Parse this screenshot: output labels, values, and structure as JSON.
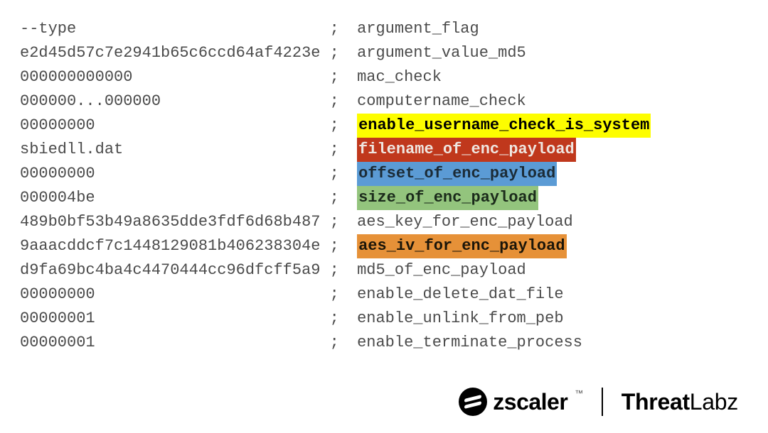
{
  "rows": [
    {
      "value": "--type",
      "semi": ";",
      "comment": "argument_flag",
      "hl": null
    },
    {
      "value": "e2d45d57c7e2941b65c6ccd64af4223e",
      "semi": ";",
      "comment": "argument_value_md5",
      "hl": null
    },
    {
      "value": "000000000000",
      "semi": ";",
      "comment": "mac_check",
      "hl": null
    },
    {
      "value": "000000...000000",
      "semi": ";",
      "comment": "computername_check",
      "hl": null
    },
    {
      "value": "00000000",
      "semi": ";",
      "comment": "enable_username_check_is_system",
      "hl": "yellow"
    },
    {
      "value": "sbiedll.dat",
      "semi": ";",
      "comment": "filename_of_enc_payload",
      "hl": "red"
    },
    {
      "value": "00000000",
      "semi": ";",
      "comment": "offset_of_enc_payload",
      "hl": "blue"
    },
    {
      "value": "000004be",
      "semi": ";",
      "comment": "size_of_enc_payload",
      "hl": "green"
    },
    {
      "value": "489b0bf53b49a8635dde3fdf6d68b487",
      "semi": ";",
      "comment": "aes_key_for_enc_payload",
      "hl": null
    },
    {
      "value": "9aaacddcf7c1448129081b406238304e",
      "semi": ";",
      "comment": "aes_iv_for_enc_payload",
      "hl": "orange"
    },
    {
      "value": "d9fa69bc4ba4c4470444cc96dfcff5a9",
      "semi": ";",
      "comment": "md5_of_enc_payload",
      "hl": null
    },
    {
      "value": "00000000",
      "semi": ";",
      "comment": "enable_delete_dat_file",
      "hl": null
    },
    {
      "value": "00000001",
      "semi": ";",
      "comment": "enable_unlink_from_peb",
      "hl": null
    },
    {
      "value": "00000001",
      "semi": ";",
      "comment": "enable_terminate_process",
      "hl": null
    }
  ],
  "layout": {
    "value_col_chars": 33,
    "semi_col_chars": 2
  },
  "footer": {
    "zscaler": "zscaler",
    "tm": "™",
    "threatlabz_bold": "Threat",
    "threatlabz_light": "Labz"
  }
}
